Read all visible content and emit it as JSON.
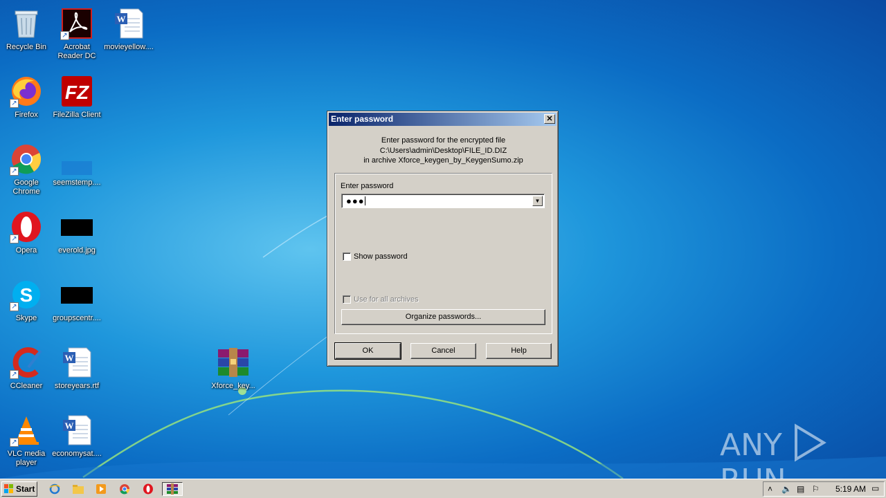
{
  "desktop": {
    "icons": [
      {
        "label": "Recycle Bin",
        "kind": "recycle"
      },
      {
        "label": "Acrobat Reader DC",
        "kind": "acrobat"
      },
      {
        "label": "movieyellow....",
        "kind": "word"
      },
      {
        "label": "Firefox",
        "kind": "firefox"
      },
      {
        "label": "FileZilla Client",
        "kind": "filezilla"
      },
      {
        "label": "Google Chrome",
        "kind": "chrome"
      },
      {
        "label": "seemstemp....",
        "kind": "blank"
      },
      {
        "label": "Opera",
        "kind": "opera"
      },
      {
        "label": "everold.jpg",
        "kind": "black"
      },
      {
        "label": "Skype",
        "kind": "skype"
      },
      {
        "label": "groupscentr....",
        "kind": "black"
      },
      {
        "label": "CCleaner",
        "kind": "ccleaner"
      },
      {
        "label": "storeyears.rtf",
        "kind": "word"
      },
      {
        "label": "Xforce_key...",
        "kind": "winrar"
      },
      {
        "label": "VLC media player",
        "kind": "vlc"
      },
      {
        "label": "economysat....",
        "kind": "word"
      }
    ]
  },
  "dialog": {
    "title": "Enter password",
    "close_glyph": "✕",
    "info_line1": "Enter password for the encrypted file",
    "info_line2": "C:\\Users\\admin\\Desktop\\FILE_ID.DIZ",
    "info_line3": "in archive Xforce_keygen_by_KeygenSumo.zip",
    "password_label": "Enter password",
    "password_value": "●●●",
    "dropdown_glyph": "▼",
    "show_password_label": "Show password",
    "show_password_checked": false,
    "use_all_label": "Use for all archives",
    "use_all_enabled": false,
    "organize_button": "Organize passwords...",
    "ok_button": "OK",
    "cancel_button": "Cancel",
    "help_button": "Help"
  },
  "taskbar": {
    "start_label": "Start",
    "quick_launch": [
      "ie-icon",
      "explorer-icon",
      "media-player-icon",
      "chrome-icon",
      "opera-icon",
      "winrar-icon"
    ],
    "tray_icons": [
      "show-hidden-icon",
      "volume-icon",
      "network-icon",
      "action-center-icon"
    ],
    "clock": "5:19 AM"
  },
  "watermark": {
    "text_left": "ANY",
    "text_right": "RUN"
  },
  "colors": {
    "titlebar_start": "#0a246a",
    "titlebar_end": "#a6caf0",
    "dialog_face": "#d4d0c8",
    "desktop_blue": "#1f97dc"
  }
}
